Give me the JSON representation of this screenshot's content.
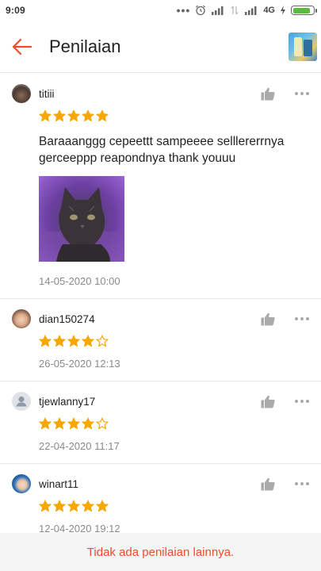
{
  "status_bar": {
    "time": "9:09",
    "network": "4G",
    "battery_level": 0.85,
    "icons": [
      "dots-icon",
      "alarm-icon",
      "signal-icon",
      "data-icon",
      "signal-icon",
      "charging-icon",
      "battery-icon"
    ]
  },
  "header": {
    "title": "Penilaian",
    "back_icon": "arrow-left-icon",
    "accent_color": "#ee4d2d"
  },
  "reviews": [
    {
      "username": "titiii",
      "rating": 5,
      "text": "Baraaanggg cepeettt sampeeee selllererrnya gerceeppp reapondnya thank youuu",
      "has_photo": true,
      "date": "14-05-2020 10:00"
    },
    {
      "username": "dian150274",
      "rating": 4,
      "text": "",
      "has_photo": false,
      "date": "26-05-2020 12:13"
    },
    {
      "username": "tjewlanny17",
      "rating": 4,
      "text": "",
      "has_photo": false,
      "date": "22-04-2020 11:17"
    },
    {
      "username": "winart11",
      "rating": 5,
      "text": "",
      "has_photo": false,
      "date": "12-04-2020 19:12"
    }
  ],
  "star_color": "#f6a700",
  "footer": {
    "text": "Tidak ada penilaian lainnya."
  }
}
